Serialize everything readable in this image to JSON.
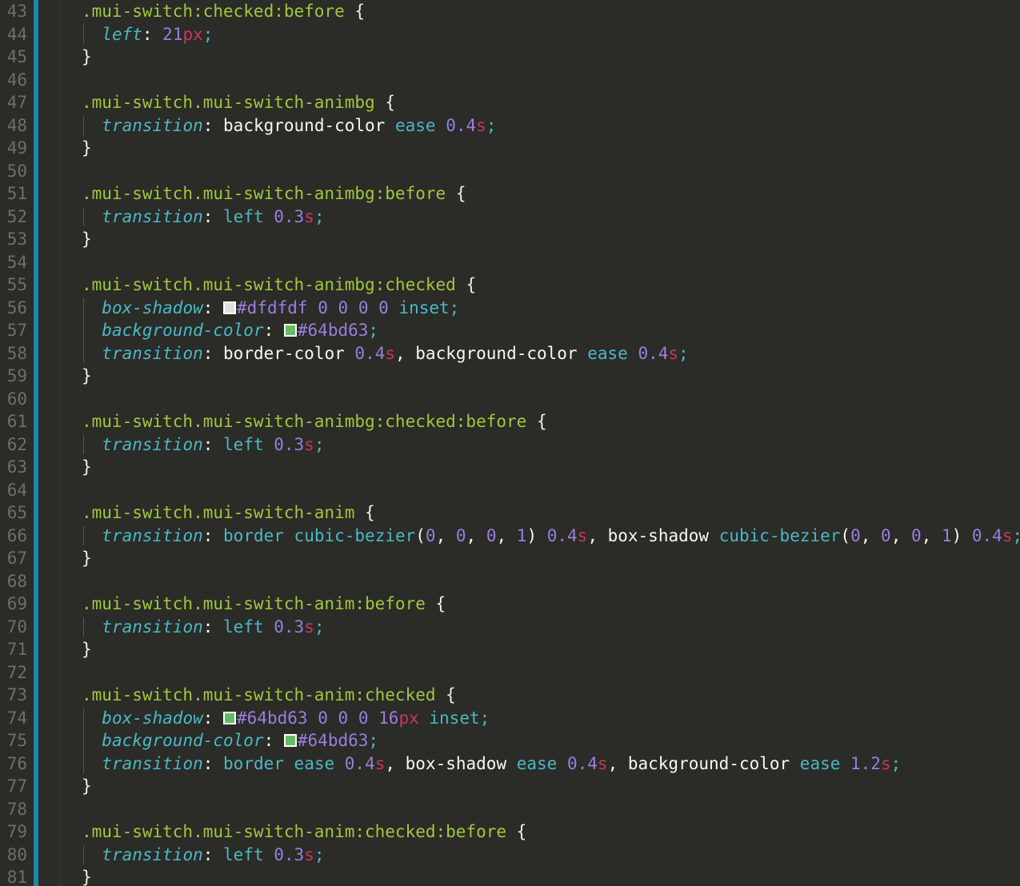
{
  "editor": {
    "theme_name": "monokai-dark",
    "colors": {
      "background": "#2b2b28",
      "gutter_accent": "#1f87a8",
      "line_number": "#6f6f68",
      "selector": "#a0c83c",
      "property": "#49b9c4",
      "number": "#9b7ede",
      "unit": "#c9365c",
      "keyword": "#49b9c4",
      "text": "#f8f8f2",
      "indent_guide": "#58584f"
    },
    "first_line_number": 43,
    "last_line_number": 81,
    "language": "CSS"
  },
  "swatches": {
    "white": "#dfdfdf",
    "green": "#64bd63"
  },
  "lines": [
    {
      "n": 43,
      "indent": 0,
      "tokens": [
        {
          "t": "sel",
          "v": ".mui-switch:checked:before"
        },
        {
          "t": "plain",
          "v": " "
        },
        {
          "t": "brace",
          "v": "{"
        }
      ]
    },
    {
      "n": 44,
      "indent": 1,
      "tokens": [
        {
          "t": "prop",
          "v": "left"
        },
        {
          "t": "colon",
          "v": ": "
        },
        {
          "t": "num",
          "v": "21"
        },
        {
          "t": "unit",
          "v": "px"
        },
        {
          "t": "semi",
          "v": ";"
        }
      ]
    },
    {
      "n": 45,
      "indent": 0,
      "tokens": [
        {
          "t": "brace",
          "v": "}"
        }
      ]
    },
    {
      "n": 46,
      "indent": 0,
      "tokens": []
    },
    {
      "n": 47,
      "indent": 0,
      "tokens": [
        {
          "t": "sel",
          "v": ".mui-switch.mui-switch-animbg"
        },
        {
          "t": "plain",
          "v": " "
        },
        {
          "t": "brace",
          "v": "{"
        }
      ]
    },
    {
      "n": 48,
      "indent": 1,
      "tokens": [
        {
          "t": "prop",
          "v": "transition"
        },
        {
          "t": "colon",
          "v": ": "
        },
        {
          "t": "plain",
          "v": "background-color "
        },
        {
          "t": "kw",
          "v": "ease"
        },
        {
          "t": "plain",
          "v": " "
        },
        {
          "t": "num",
          "v": "0.4"
        },
        {
          "t": "unit",
          "v": "s"
        },
        {
          "t": "semi",
          "v": ";"
        }
      ]
    },
    {
      "n": 49,
      "indent": 0,
      "tokens": [
        {
          "t": "brace",
          "v": "}"
        }
      ]
    },
    {
      "n": 50,
      "indent": 0,
      "tokens": []
    },
    {
      "n": 51,
      "indent": 0,
      "tokens": [
        {
          "t": "sel",
          "v": ".mui-switch.mui-switch-animbg:before"
        },
        {
          "t": "plain",
          "v": " "
        },
        {
          "t": "brace",
          "v": "{"
        }
      ]
    },
    {
      "n": 52,
      "indent": 1,
      "tokens": [
        {
          "t": "prop",
          "v": "transition"
        },
        {
          "t": "colon",
          "v": ": "
        },
        {
          "t": "kw",
          "v": "left"
        },
        {
          "t": "plain",
          "v": " "
        },
        {
          "t": "num",
          "v": "0.3"
        },
        {
          "t": "unit",
          "v": "s"
        },
        {
          "t": "semi",
          "v": ";"
        }
      ]
    },
    {
      "n": 53,
      "indent": 0,
      "tokens": [
        {
          "t": "brace",
          "v": "}"
        }
      ]
    },
    {
      "n": 54,
      "indent": 0,
      "tokens": []
    },
    {
      "n": 55,
      "indent": 0,
      "tokens": [
        {
          "t": "sel",
          "v": ".mui-switch.mui-switch-animbg:checked"
        },
        {
          "t": "plain",
          "v": " "
        },
        {
          "t": "brace",
          "v": "{"
        }
      ]
    },
    {
      "n": 56,
      "indent": 1,
      "tokens": [
        {
          "t": "prop",
          "v": "box-shadow"
        },
        {
          "t": "colon",
          "v": ": "
        },
        {
          "t": "swatch",
          "v": "#dfdfdf"
        },
        {
          "t": "hex",
          "v": "#dfdfdf"
        },
        {
          "t": "plain",
          "v": " "
        },
        {
          "t": "num",
          "v": "0"
        },
        {
          "t": "plain",
          "v": " "
        },
        {
          "t": "num",
          "v": "0"
        },
        {
          "t": "plain",
          "v": " "
        },
        {
          "t": "num",
          "v": "0"
        },
        {
          "t": "plain",
          "v": " "
        },
        {
          "t": "num",
          "v": "0"
        },
        {
          "t": "plain",
          "v": " "
        },
        {
          "t": "kw",
          "v": "inset"
        },
        {
          "t": "semi",
          "v": ";"
        }
      ]
    },
    {
      "n": 57,
      "indent": 1,
      "tokens": [
        {
          "t": "prop",
          "v": "background-color"
        },
        {
          "t": "colon",
          "v": ": "
        },
        {
          "t": "swatch",
          "v": "#64bd63"
        },
        {
          "t": "hex",
          "v": "#64bd63"
        },
        {
          "t": "semi",
          "v": ";"
        }
      ]
    },
    {
      "n": 58,
      "indent": 1,
      "tokens": [
        {
          "t": "prop",
          "v": "transition"
        },
        {
          "t": "colon",
          "v": ": "
        },
        {
          "t": "plain",
          "v": "border-color "
        },
        {
          "t": "num",
          "v": "0.4"
        },
        {
          "t": "unit",
          "v": "s"
        },
        {
          "t": "plain",
          "v": ", background-color "
        },
        {
          "t": "kw",
          "v": "ease"
        },
        {
          "t": "plain",
          "v": " "
        },
        {
          "t": "num",
          "v": "0.4"
        },
        {
          "t": "unit",
          "v": "s"
        },
        {
          "t": "semi",
          "v": ";"
        }
      ]
    },
    {
      "n": 59,
      "indent": 0,
      "tokens": [
        {
          "t": "brace",
          "v": "}"
        }
      ]
    },
    {
      "n": 60,
      "indent": 0,
      "tokens": []
    },
    {
      "n": 61,
      "indent": 0,
      "tokens": [
        {
          "t": "sel",
          "v": ".mui-switch.mui-switch-animbg:checked:before"
        },
        {
          "t": "plain",
          "v": " "
        },
        {
          "t": "brace",
          "v": "{"
        }
      ]
    },
    {
      "n": 62,
      "indent": 1,
      "tokens": [
        {
          "t": "prop",
          "v": "transition"
        },
        {
          "t": "colon",
          "v": ": "
        },
        {
          "t": "kw",
          "v": "left"
        },
        {
          "t": "plain",
          "v": " "
        },
        {
          "t": "num",
          "v": "0.3"
        },
        {
          "t": "unit",
          "v": "s"
        },
        {
          "t": "semi",
          "v": ";"
        }
      ]
    },
    {
      "n": 63,
      "indent": 0,
      "tokens": [
        {
          "t": "brace",
          "v": "}"
        }
      ]
    },
    {
      "n": 64,
      "indent": 0,
      "tokens": []
    },
    {
      "n": 65,
      "indent": 0,
      "tokens": [
        {
          "t": "sel",
          "v": ".mui-switch.mui-switch-anim"
        },
        {
          "t": "plain",
          "v": " "
        },
        {
          "t": "brace",
          "v": "{"
        }
      ]
    },
    {
      "n": 66,
      "indent": 1,
      "tokens": [
        {
          "t": "prop",
          "v": "transition"
        },
        {
          "t": "colon",
          "v": ": "
        },
        {
          "t": "kw",
          "v": "border"
        },
        {
          "t": "plain",
          "v": " "
        },
        {
          "t": "kw",
          "v": "cubic-bezier"
        },
        {
          "t": "plain",
          "v": "("
        },
        {
          "t": "num",
          "v": "0"
        },
        {
          "t": "plain",
          "v": ", "
        },
        {
          "t": "num",
          "v": "0"
        },
        {
          "t": "plain",
          "v": ", "
        },
        {
          "t": "num",
          "v": "0"
        },
        {
          "t": "plain",
          "v": ", "
        },
        {
          "t": "num",
          "v": "1"
        },
        {
          "t": "plain",
          "v": ") "
        },
        {
          "t": "num",
          "v": "0.4"
        },
        {
          "t": "unit",
          "v": "s"
        },
        {
          "t": "plain",
          "v": ", box-shadow "
        },
        {
          "t": "kw",
          "v": "cubic-bezier"
        },
        {
          "t": "plain",
          "v": "("
        },
        {
          "t": "num",
          "v": "0"
        },
        {
          "t": "plain",
          "v": ", "
        },
        {
          "t": "num",
          "v": "0"
        },
        {
          "t": "plain",
          "v": ", "
        },
        {
          "t": "num",
          "v": "0"
        },
        {
          "t": "plain",
          "v": ", "
        },
        {
          "t": "num",
          "v": "1"
        },
        {
          "t": "plain",
          "v": ") "
        },
        {
          "t": "num",
          "v": "0.4"
        },
        {
          "t": "unit",
          "v": "s"
        },
        {
          "t": "semi",
          "v": ";"
        }
      ]
    },
    {
      "n": 67,
      "indent": 0,
      "tokens": [
        {
          "t": "brace",
          "v": "}"
        }
      ]
    },
    {
      "n": 68,
      "indent": 0,
      "tokens": []
    },
    {
      "n": 69,
      "indent": 0,
      "tokens": [
        {
          "t": "sel",
          "v": ".mui-switch.mui-switch-anim:before"
        },
        {
          "t": "plain",
          "v": " "
        },
        {
          "t": "brace",
          "v": "{"
        }
      ]
    },
    {
      "n": 70,
      "indent": 1,
      "tokens": [
        {
          "t": "prop",
          "v": "transition"
        },
        {
          "t": "colon",
          "v": ": "
        },
        {
          "t": "kw",
          "v": "left"
        },
        {
          "t": "plain",
          "v": " "
        },
        {
          "t": "num",
          "v": "0.3"
        },
        {
          "t": "unit",
          "v": "s"
        },
        {
          "t": "semi",
          "v": ";"
        }
      ]
    },
    {
      "n": 71,
      "indent": 0,
      "tokens": [
        {
          "t": "brace",
          "v": "}"
        }
      ]
    },
    {
      "n": 72,
      "indent": 0,
      "tokens": []
    },
    {
      "n": 73,
      "indent": 0,
      "tokens": [
        {
          "t": "sel",
          "v": ".mui-switch.mui-switch-anim:checked"
        },
        {
          "t": "plain",
          "v": " "
        },
        {
          "t": "brace",
          "v": "{"
        }
      ]
    },
    {
      "n": 74,
      "indent": 1,
      "tokens": [
        {
          "t": "prop",
          "v": "box-shadow"
        },
        {
          "t": "colon",
          "v": ": "
        },
        {
          "t": "swatch",
          "v": "#64bd63"
        },
        {
          "t": "hex",
          "v": "#64bd63"
        },
        {
          "t": "plain",
          "v": " "
        },
        {
          "t": "num",
          "v": "0"
        },
        {
          "t": "plain",
          "v": " "
        },
        {
          "t": "num",
          "v": "0"
        },
        {
          "t": "plain",
          "v": " "
        },
        {
          "t": "num",
          "v": "0"
        },
        {
          "t": "plain",
          "v": " "
        },
        {
          "t": "num",
          "v": "16"
        },
        {
          "t": "unit",
          "v": "px"
        },
        {
          "t": "plain",
          "v": " "
        },
        {
          "t": "kw",
          "v": "inset"
        },
        {
          "t": "semi",
          "v": ";"
        }
      ]
    },
    {
      "n": 75,
      "indent": 1,
      "tokens": [
        {
          "t": "prop",
          "v": "background-color"
        },
        {
          "t": "colon",
          "v": ": "
        },
        {
          "t": "swatch",
          "v": "#64bd63"
        },
        {
          "t": "hex",
          "v": "#64bd63"
        },
        {
          "t": "semi",
          "v": ";"
        }
      ]
    },
    {
      "n": 76,
      "indent": 1,
      "tokens": [
        {
          "t": "prop",
          "v": "transition"
        },
        {
          "t": "colon",
          "v": ": "
        },
        {
          "t": "kw",
          "v": "border"
        },
        {
          "t": "plain",
          "v": " "
        },
        {
          "t": "kw",
          "v": "ease"
        },
        {
          "t": "plain",
          "v": " "
        },
        {
          "t": "num",
          "v": "0.4"
        },
        {
          "t": "unit",
          "v": "s"
        },
        {
          "t": "plain",
          "v": ", box-shadow "
        },
        {
          "t": "kw",
          "v": "ease"
        },
        {
          "t": "plain",
          "v": " "
        },
        {
          "t": "num",
          "v": "0.4"
        },
        {
          "t": "unit",
          "v": "s"
        },
        {
          "t": "plain",
          "v": ", background-color "
        },
        {
          "t": "kw",
          "v": "ease"
        },
        {
          "t": "plain",
          "v": " "
        },
        {
          "t": "num",
          "v": "1.2"
        },
        {
          "t": "unit",
          "v": "s"
        },
        {
          "t": "semi",
          "v": ";"
        }
      ]
    },
    {
      "n": 77,
      "indent": 0,
      "tokens": [
        {
          "t": "brace",
          "v": "}"
        }
      ]
    },
    {
      "n": 78,
      "indent": 0,
      "tokens": []
    },
    {
      "n": 79,
      "indent": 0,
      "tokens": [
        {
          "t": "sel",
          "v": ".mui-switch.mui-switch-anim:checked:before"
        },
        {
          "t": "plain",
          "v": " "
        },
        {
          "t": "brace",
          "v": "{"
        }
      ]
    },
    {
      "n": 80,
      "indent": 1,
      "tokens": [
        {
          "t": "prop",
          "v": "transition"
        },
        {
          "t": "colon",
          "v": ": "
        },
        {
          "t": "kw",
          "v": "left"
        },
        {
          "t": "plain",
          "v": " "
        },
        {
          "t": "num",
          "v": "0.3"
        },
        {
          "t": "unit",
          "v": "s"
        },
        {
          "t": "semi",
          "v": ";"
        }
      ]
    },
    {
      "n": 81,
      "indent": 0,
      "tokens": [
        {
          "t": "brace",
          "v": "}"
        }
      ]
    }
  ]
}
